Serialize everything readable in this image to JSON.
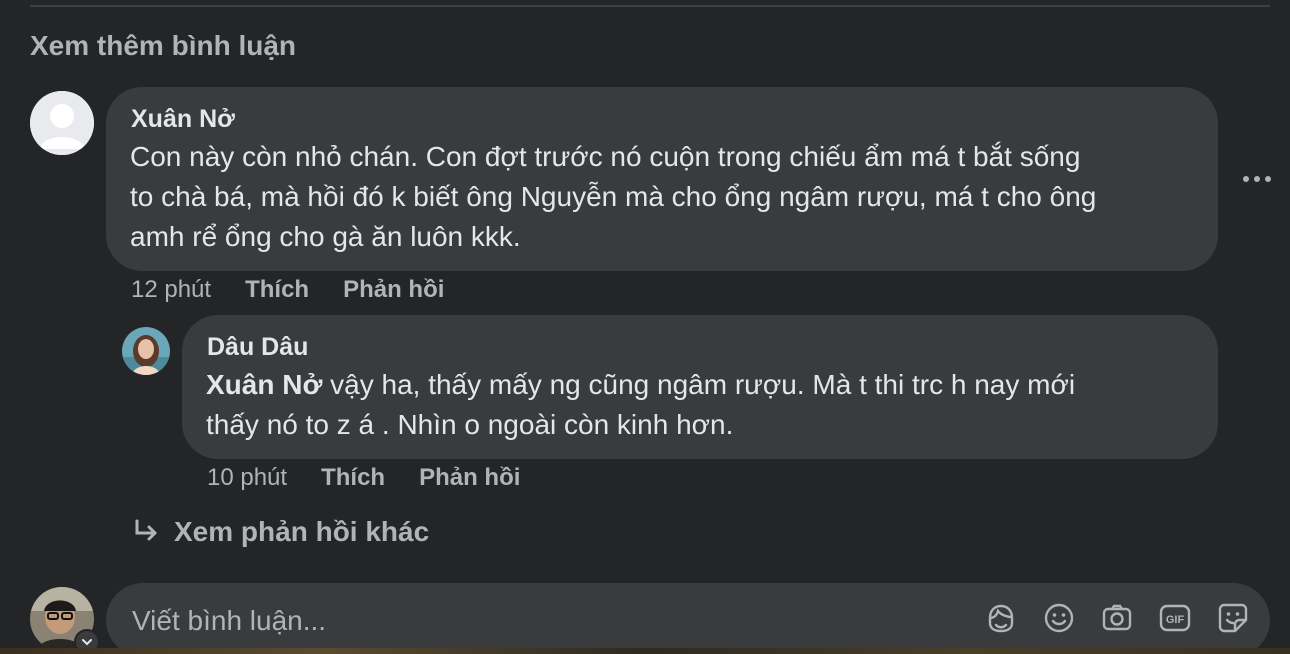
{
  "more_comments_label": "Xem thêm bình luận",
  "comments": [
    {
      "author": "Xuân Nở",
      "text_lines": [
        "Con này còn nhỏ chán. Con đợt trước nó cuộn trong chiếu ẩm má t bắt sống",
        "to chà bá, mà hồi đó k biết ông Nguyễn mà cho ổng ngâm rượu, má t cho ông",
        "amh rể ổng cho gà ăn luôn kkk."
      ],
      "time": "12 phút",
      "like_label": "Thích",
      "reply_label": "Phản hồi"
    }
  ],
  "reply": {
    "author": "Dâu Dâu",
    "mention": "Xuân Nở",
    "text_line1_rest": " vậy ha, thấy mấy ng cũng ngâm rượu. Mà t thi trc h nay mới",
    "text_line2": "thấy nó to z á . Nhìn o ngoài còn kinh hơn.",
    "time": "10 phút",
    "like_label": "Thích",
    "reply_label": "Phản hồi"
  },
  "view_more_replies_label": "Xem phản hồi khác",
  "composer": {
    "placeholder": "Viết bình luận...",
    "icons": [
      "avatar-sticker-icon",
      "emoji-icon",
      "camera-icon",
      "gif-icon",
      "sticker-icon"
    ]
  }
}
